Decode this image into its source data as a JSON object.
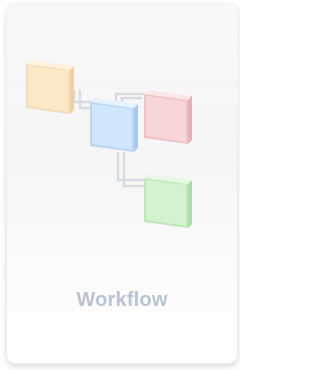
{
  "tile": {
    "label": "Workflow",
    "icon": "workflow-diagram-icon",
    "colors": {
      "node_orange": "#fde8c8",
      "node_blue": "#cfe6fb",
      "node_red": "#f7d5d8",
      "node_green": "#d4f1d0",
      "connector": "#d7dbe2",
      "label": "#b9c3d3"
    }
  }
}
